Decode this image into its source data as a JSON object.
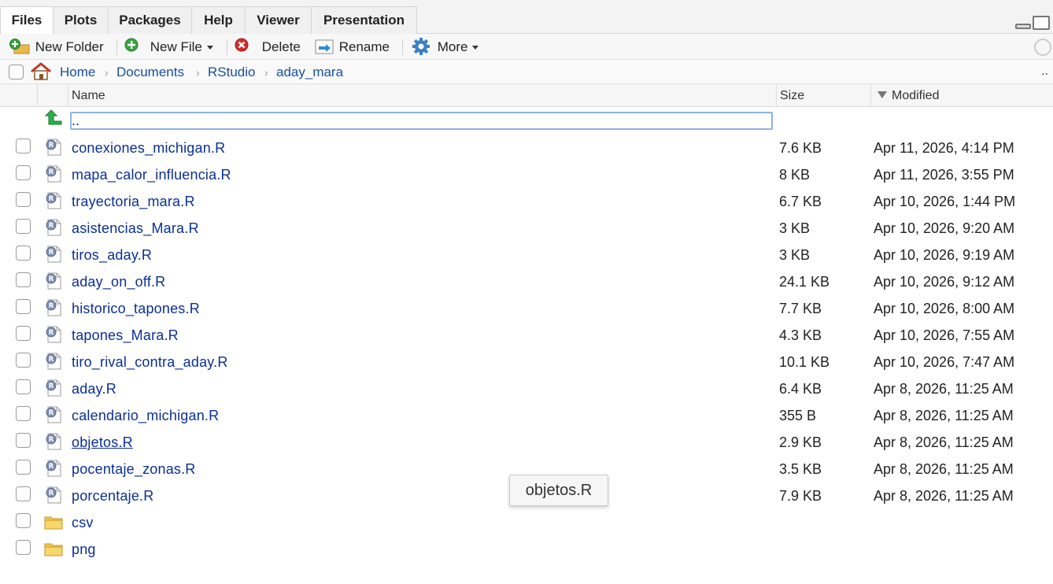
{
  "tabs": [
    {
      "label": "Files",
      "active": true
    },
    {
      "label": "Plots"
    },
    {
      "label": "Packages"
    },
    {
      "label": "Help"
    },
    {
      "label": "Viewer"
    },
    {
      "label": "Presentation"
    }
  ],
  "toolbar": {
    "new_folder": "New Folder",
    "new_file": "New File",
    "delete": "Delete",
    "rename": "Rename",
    "more": "More"
  },
  "breadcrumb": {
    "items": [
      "Home",
      "Documents",
      "RStudio",
      "aday_mara"
    ],
    "overflow": ".."
  },
  "header": {
    "name": "Name",
    "size": "Size",
    "modified": "Modified"
  },
  "parent_dir": "..",
  "files": [
    {
      "name": "conexiones_michigan.R",
      "size": "7.6 KB",
      "modified": "Apr 11, 2026, 4:14 PM",
      "type": "r"
    },
    {
      "name": "mapa_calor_influencia.R",
      "size": "8 KB",
      "modified": "Apr 11, 2026, 3:55 PM",
      "type": "r"
    },
    {
      "name": "trayectoria_mara.R",
      "size": "6.7 KB",
      "modified": "Apr 10, 2026, 1:44 PM",
      "type": "r"
    },
    {
      "name": "asistencias_Mara.R",
      "size": "3 KB",
      "modified": "Apr 10, 2026, 9:20 AM",
      "type": "r"
    },
    {
      "name": "tiros_aday.R",
      "size": "3 KB",
      "modified": "Apr 10, 2026, 9:19 AM",
      "type": "r"
    },
    {
      "name": "aday_on_off.R",
      "size": "24.1 KB",
      "modified": "Apr 10, 2026, 9:12 AM",
      "type": "r"
    },
    {
      "name": "historico_tapones.R",
      "size": "7.7 KB",
      "modified": "Apr 10, 2026, 8:00 AM",
      "type": "r"
    },
    {
      "name": "tapones_Mara.R",
      "size": "4.3 KB",
      "modified": "Apr 10, 2026, 7:55 AM",
      "type": "r"
    },
    {
      "name": "tiro_rival_contra_aday.R",
      "size": "10.1 KB",
      "modified": "Apr 10, 2026, 7:47 AM",
      "type": "r"
    },
    {
      "name": "aday.R",
      "size": "6.4 KB",
      "modified": "Apr 8, 2026, 11:25 AM",
      "type": "r"
    },
    {
      "name": "calendario_michigan.R",
      "size": "355 B",
      "modified": "Apr 8, 2026, 11:25 AM",
      "type": "r"
    },
    {
      "name": "objetos.R",
      "size": "2.9 KB",
      "modified": "Apr 8, 2026, 11:25 AM",
      "type": "r",
      "hovered": true
    },
    {
      "name": "pocentaje_zonas.R",
      "size": "3.5 KB",
      "modified": "Apr 8, 2026, 11:25 AM",
      "type": "r"
    },
    {
      "name": "porcentaje.R",
      "size": "7.9 KB",
      "modified": "Apr 8, 2026, 11:25 AM",
      "type": "r"
    },
    {
      "name": "csv",
      "size": "",
      "modified": "",
      "type": "folder"
    },
    {
      "name": "png",
      "size": "",
      "modified": "",
      "type": "folder"
    }
  ],
  "tooltip": "objetos.R",
  "colors": {
    "link": "#0b2f95",
    "breadcrumb": "#1a4ea1",
    "folder": "#f2c94c"
  }
}
